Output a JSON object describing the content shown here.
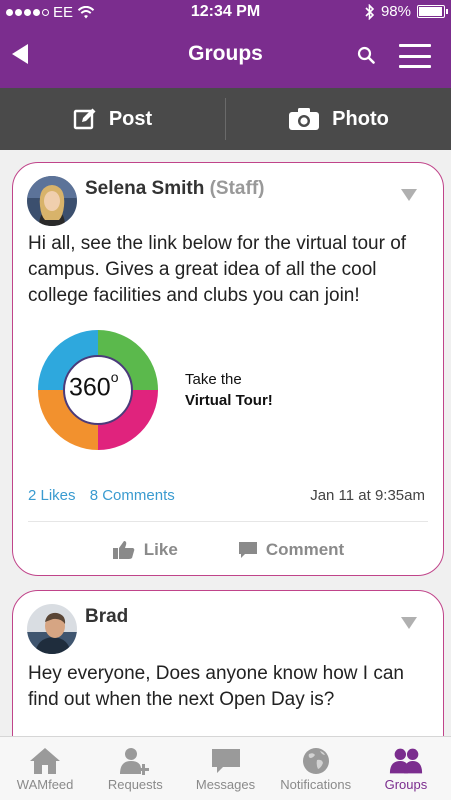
{
  "status_bar": {
    "carrier": "EE",
    "time": "12:34 PM",
    "battery": "98%",
    "battery_level": 0.98
  },
  "nav": {
    "title": "Groups"
  },
  "actions": {
    "post_label": "Post",
    "photo_label": "Photo"
  },
  "posts": [
    {
      "author": "Selena Smith",
      "role": "(Staff)",
      "text": "Hi all, see the link below for the virtual tour of campus. Gives a great idea of all the cool college facilities and clubs you can join!",
      "tour": {
        "number": "360",
        "degree": "o",
        "line1": "Take the",
        "line2": "Virtual Tour!"
      },
      "likes": "2 Likes",
      "comments": "8 Comments",
      "date": "Jan 11 at 9:35am",
      "like_label": "Like",
      "comment_label": "Comment"
    },
    {
      "author": "Brad",
      "role": "",
      "text": "Hey everyone, Does anyone know how I can find out when the next Open Day is?"
    }
  ],
  "tabs": [
    {
      "label": "WAMfeed",
      "icon": "home-icon"
    },
    {
      "label": "Requests",
      "icon": "add-user-icon"
    },
    {
      "label": "Messages",
      "icon": "chat-icon"
    },
    {
      "label": "Notifications",
      "icon": "globe-icon"
    },
    {
      "label": "Groups",
      "icon": "group-icon",
      "active": true
    }
  ],
  "colors": {
    "brand": "#7b2d8e",
    "card_border": "#c0448a",
    "link": "#3a9bd0",
    "action_bar": "#4a4a4a"
  }
}
